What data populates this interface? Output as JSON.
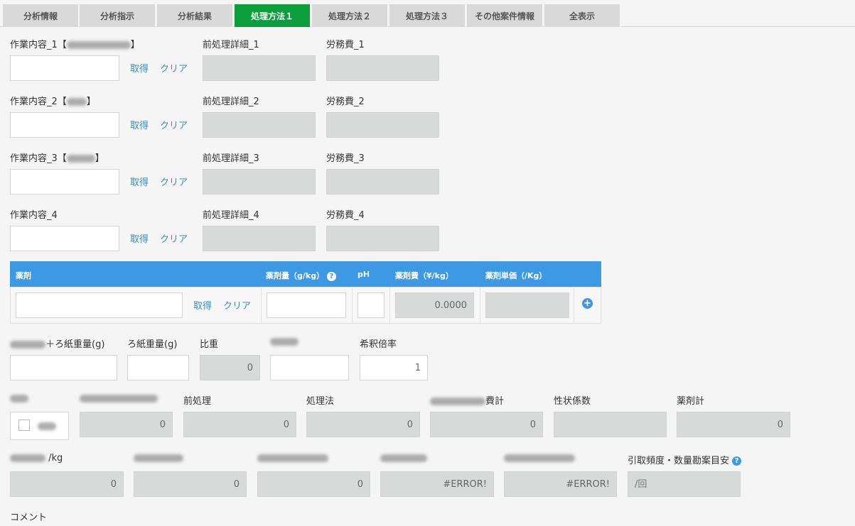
{
  "tabs": [
    "分析情報",
    "分析指示",
    "分析結果",
    "処理方法１",
    "処理方法２",
    "処理方法３",
    "その他案件情報",
    "全表示"
  ],
  "active_tab": "処理方法１",
  "work_rows": [
    {
      "work_label": "作業内容_1",
      "bracket_open": "【",
      "bracket_close": "】",
      "detail_label": "前処理詳細_1",
      "labor_label": "労務費_1",
      "get": "取得",
      "clear": "クリア"
    },
    {
      "work_label": "作業内容_2",
      "bracket_open": "【",
      "bracket_close": "】",
      "detail_label": "前処理詳細_2",
      "labor_label": "労務費_2",
      "get": "取得",
      "clear": "クリア"
    },
    {
      "work_label": "作業内容_3",
      "bracket_open": "【",
      "bracket_close": "】",
      "detail_label": "前処理詳細_3",
      "labor_label": "労務費_3",
      "get": "取得",
      "clear": "クリア"
    },
    {
      "work_label": "作業内容_4",
      "bracket_open": "",
      "bracket_close": "",
      "detail_label": "前処理詳細_4",
      "labor_label": "労務費_4",
      "get": "取得",
      "clear": "クリア"
    }
  ],
  "reagent": {
    "headers": {
      "name": "薬剤",
      "amount": "薬剤量（g/kg）",
      "ph": "pH",
      "cost": "薬剤費（¥/kg）",
      "unit_price": "薬剤単価（/Kg）"
    },
    "help_icon": "?",
    "get": "取得",
    "clear": "クリア",
    "cost_value": "0.0000",
    "add_icon": "+"
  },
  "weights": {
    "filter_plus_suffix": "＋ろ紙重量(g)",
    "filter_label": "ろ紙重量(g)",
    "gravity_label": "比重",
    "gravity_value": "0",
    "dilution_label": "希釈倍率",
    "dilution_value": "1"
  },
  "totals": {
    "pretreat_label": "前処理",
    "method_label": "処理法",
    "cost_total_suffix": "費計",
    "property_label": "性状係数",
    "reagent_total_label": "薬剤計",
    "values": [
      "0",
      "0",
      "0",
      "0",
      "",
      "0"
    ]
  },
  "per_kg": {
    "first_suffix": "/kg",
    "values": [
      "0",
      "0",
      "0",
      "#ERROR!",
      "#ERROR!"
    ],
    "frequency_label": "引取頻度・数量勘案目安",
    "frequency_placeholder": "/回"
  },
  "comment_label": "コメント"
}
